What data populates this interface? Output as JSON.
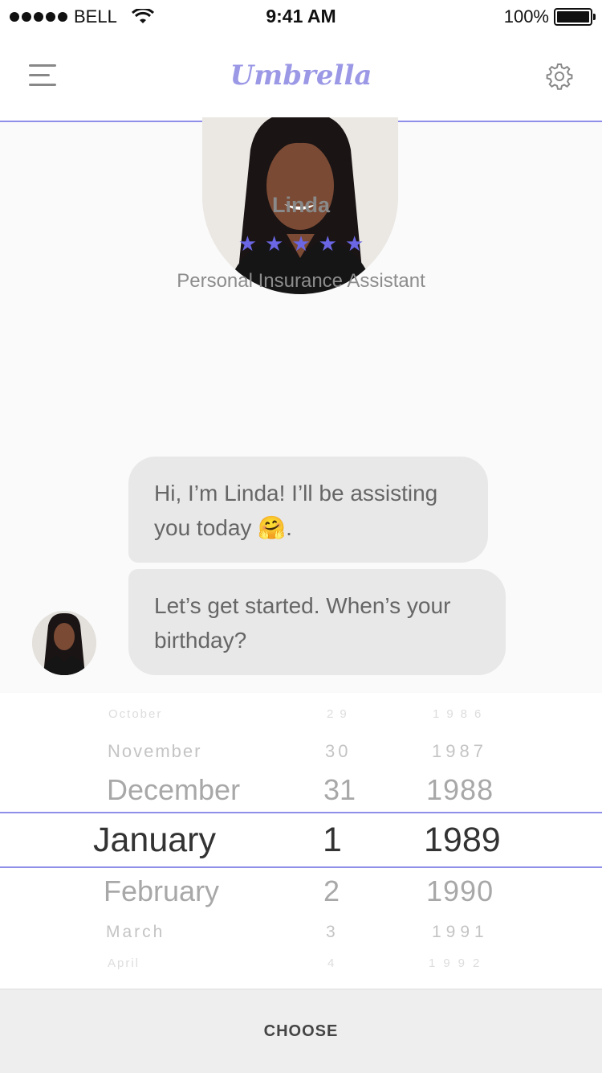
{
  "status_bar": {
    "carrier": "BELL",
    "time": "9:41 AM",
    "battery": "100%"
  },
  "nav": {
    "title": "Umbrella"
  },
  "assistant": {
    "name": "Linda",
    "rating": 5,
    "role": "Personal Insurance Assistant"
  },
  "messages": [
    {
      "text": "Hi, I’m Linda! I’ll be assisting you today 🤗."
    },
    {
      "text": "Let’s get started. When’s your birthday?"
    }
  ],
  "picker": {
    "months": [
      "October",
      "November",
      "December",
      "January",
      "February",
      "March",
      "April"
    ],
    "days": [
      "29",
      "30",
      "31",
      "1",
      "2",
      "3",
      "4"
    ],
    "years": [
      "1986",
      "1987",
      "1988",
      "1989",
      "1990",
      "1991",
      "1992"
    ],
    "selected": {
      "month": "January",
      "day": "1",
      "year": "1989"
    }
  },
  "action": {
    "choose_label": "CHOOSE"
  },
  "colors": {
    "accent": "#6b66e3",
    "title": "#9b98e6",
    "divider": "#8f8ee8"
  }
}
